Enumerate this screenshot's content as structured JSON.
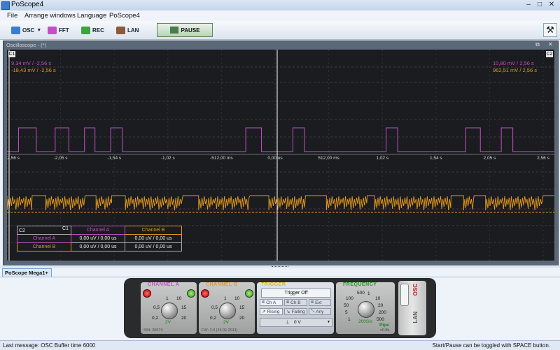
{
  "window": {
    "title": "PoScope4"
  },
  "menu": [
    "File",
    "Arrange windows",
    "Language",
    "PoScope4"
  ],
  "toolbar": {
    "osc": "OSC",
    "fft": "FFT",
    "rec": "REC",
    "lan": "LAN",
    "pause": "PAUSE"
  },
  "osc_window": {
    "title": "Oscilloscope - (*)",
    "c1": "C1",
    "c2": "C2",
    "readouts": {
      "left_top": "9,34 mV / -2,56 s",
      "left_bottom": "-18,43 mV / -2,56 s",
      "right_top": "10,80 mV / 2,56 s",
      "right_bottom": "962,51 mV / 2,56 s"
    },
    "time_ticks": [
      "-2,56 s",
      "-2,05 s",
      "-1,54 s",
      "-1,02 s",
      "-512,00 ms",
      "0,00 us",
      "512,00 ms",
      "1,02 s",
      "1,54 s",
      "2,05 s",
      "2,56 s"
    ],
    "measure_table": {
      "corner_c1": "C1",
      "corner_c2": "C2",
      "col_a": "Channel A",
      "col_b": "Channel B",
      "row_a": "Channel A",
      "row_b": "Channel B",
      "aa": "0,00 uV / 0,00 us",
      "ab": "0,00 uV / 0,00 us",
      "ba": "0,00 uV / 0,00 us",
      "bb": "0,00 uV / 0,00 us"
    }
  },
  "panel": {
    "tab": "PoScope Mega1+",
    "channel_a": {
      "label": "CHANNEL A",
      "ticks": [
        "1",
        "10",
        "0,5",
        "15",
        "0,2",
        "20"
      ],
      "value": "2V",
      "serial": "S/N: 20574"
    },
    "channel_b": {
      "label": "CHANNEL B",
      "ticks": [
        "1",
        "10",
        "0,5",
        "15",
        "0,2",
        "20"
      ],
      "value": "2V",
      "fw": "FW: 2.0 (24.01.2011)"
    },
    "trigger": {
      "label": "TRIGGER",
      "mode": "Trigger Off",
      "ch_a": "Ch A",
      "ch_b": "Ch B",
      "ext": "Ext",
      "rising": "Rising",
      "falling": "Falling",
      "any": "Any",
      "level": "0 V"
    },
    "frequency": {
      "label": "FREQUENCY",
      "ticks": [
        "500",
        "1",
        "100",
        "10",
        "50",
        "20",
        "5",
        "200",
        "1",
        "500"
      ],
      "value": "200S/s",
      "mode": "Pipe",
      "version": "v0.8b"
    },
    "side_osc": "OSC",
    "side_lan": "LAN"
  },
  "status": {
    "left": "Last message: OSC Buffer time 6000",
    "right": "Start/Pause can be toggled with SPACE button."
  },
  "colors": {
    "channel_a": "#c44fc4",
    "channel_b": "#e59a1c",
    "scope_bg": "#1a1c1f"
  },
  "chart_data": {
    "type": "line",
    "x_range_s": [
      -2.56,
      2.56
    ],
    "series": [
      {
        "name": "Channel A",
        "pulses_s": [
          [
            -2.45,
            -2.28
          ],
          [
            -2.1,
            -1.97
          ],
          [
            -1.82,
            -1.72
          ],
          [
            -1.57,
            -1.46
          ],
          [
            -0.28,
            -0.13
          ],
          [
            0.17,
            0.28
          ],
          [
            1.06,
            1.17
          ],
          [
            1.82,
            1.96
          ],
          [
            2.16,
            2.27
          ]
        ]
      },
      {
        "name": "Channel B",
        "pulses_s": [
          [
            -2.56,
            -2.32
          ],
          [
            -2.19,
            -1.81
          ],
          [
            -1.71,
            -1.56
          ],
          [
            -1.43,
            -0.88
          ],
          [
            -0.73,
            -0.24
          ],
          [
            -0.06,
            0.29
          ],
          [
            0.49,
            0.88
          ],
          [
            0.95,
            1.68
          ],
          [
            1.8,
            1.9
          ],
          [
            2.01,
            2.56
          ]
        ]
      }
    ]
  }
}
